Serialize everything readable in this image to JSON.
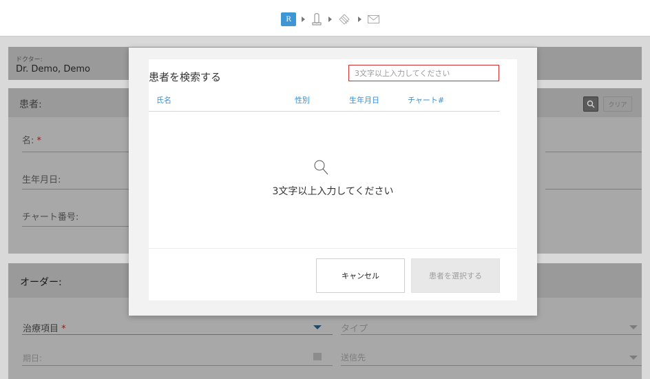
{
  "wizard": {
    "steps": [
      {
        "name": "step-rx",
        "letter": "R",
        "active": true
      },
      {
        "name": "step-scan"
      },
      {
        "name": "step-view"
      },
      {
        "name": "step-send"
      }
    ]
  },
  "doctor": {
    "label": "ドクター:",
    "value": "Dr. Demo, Demo"
  },
  "patient_section": {
    "title": "患者:",
    "search_button_icon": "search-icon",
    "clear_label": "クリア",
    "fields": {
      "name_label": "名:",
      "dob_label": "生年月日:",
      "chart_label": "チャート番号:"
    }
  },
  "order_section": {
    "title": "オーダー:",
    "treatment_label": "治療項目",
    "type_label": "タイプ",
    "due_label": "期日:",
    "ship_label": "送信先"
  },
  "required_mark": "*",
  "modal": {
    "title": "患者を検索する",
    "search_placeholder": "3文字以上入力してください",
    "columns": [
      "氏名",
      "性別",
      "生年月日",
      "チャート#"
    ],
    "empty_message": "3文字以上入力してください",
    "cancel_label": "キャンセル",
    "select_label": "患者を選択する"
  }
}
